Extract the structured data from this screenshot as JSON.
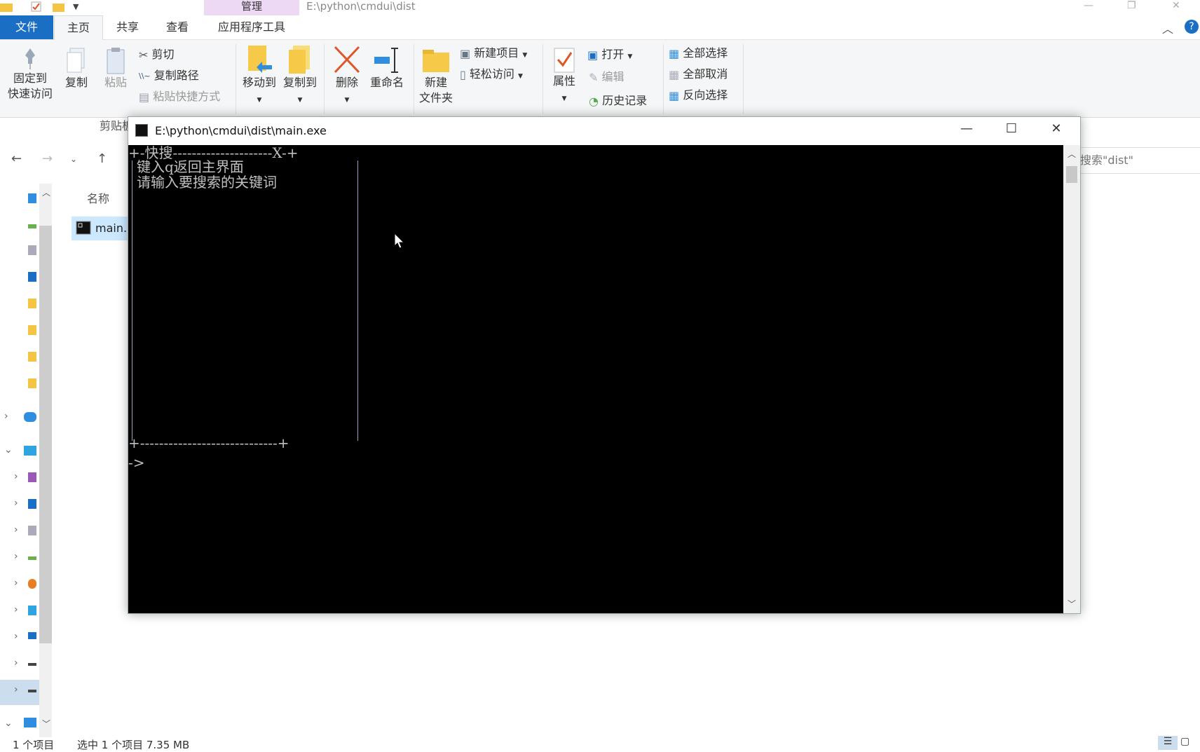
{
  "explorer": {
    "title": "E:\\python\\cmdui\\dist",
    "manage_tab": "管理",
    "tabs": {
      "file": "文件",
      "home": "主页",
      "share": "共享",
      "view": "查看",
      "apptools": "应用程序工具"
    },
    "ribbon": {
      "pin": [
        "固定到",
        "快速访问"
      ],
      "copy": "复制",
      "paste": "粘贴",
      "cut": "剪切",
      "copy_path": "复制路径",
      "paste_shortcut": "粘贴快捷方式",
      "clipboard_group": "剪贴板",
      "move_to": "移动到",
      "copy_to": "复制到",
      "delete": "删除",
      "rename": "重命名",
      "new_folder": [
        "新建",
        "文件夹"
      ],
      "new_item": "新建项目",
      "easy_access": "轻松访问",
      "properties": "属性",
      "open": "打开",
      "edit": "编辑",
      "history": "历史记录",
      "select_all": "全部选择",
      "select_none": "全部取消",
      "invert_selection": "反向选择"
    },
    "search_placeholder": "搜索\"dist\"",
    "column_name": "名称",
    "file_item": "main.e",
    "status": {
      "count": "1 个项目",
      "selected": "选中 1 个项目  7.35 MB"
    }
  },
  "console": {
    "title": "E:\\python\\cmdui\\dist\\main.exe",
    "frame_top": "+-快搜---------------------X-+",
    "frame_bottom": "+-----------------------------+",
    "lines": [
      "键入q返回主界面",
      "请输入要搜索的关键词"
    ],
    "prompt": "->"
  },
  "colors": {
    "accent": "#1a6fc4",
    "manage_tab": "#eed9f5",
    "selection": "#cce8ff"
  }
}
